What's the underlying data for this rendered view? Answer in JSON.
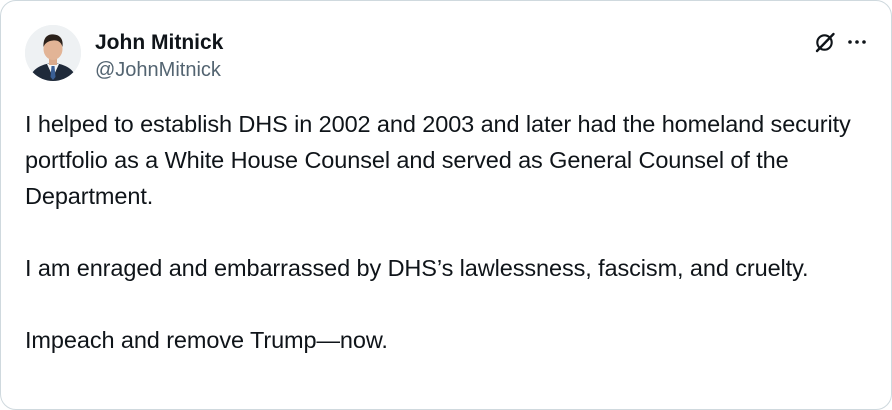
{
  "author": {
    "display_name": "John Mitnick",
    "handle": "@JohnMitnick"
  },
  "icons": {
    "avatar": "profile-photo",
    "grok": "grok-icon",
    "more": "more-options-icon"
  },
  "tweet": {
    "paragraphs": [
      "I helped to establish DHS in 2002 and 2003 and later had the homeland security portfolio as a White House Counsel and served as General Counsel of the Department.",
      "I am enraged and embarrassed by DHS’s lawlessness, fascism, and cruelty.",
      "Impeach and remove Trump—now."
    ]
  },
  "colors": {
    "text_primary": "#0f1419",
    "text_secondary": "#536471",
    "border": "#cfd9de"
  }
}
